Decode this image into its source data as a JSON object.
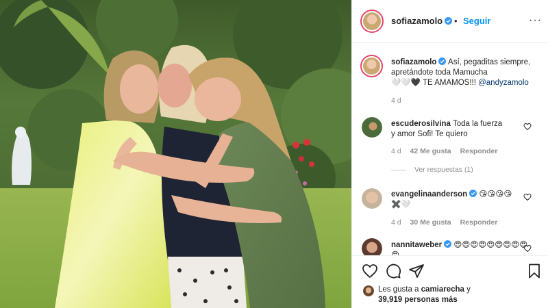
{
  "post": {
    "username": "sofiazamolo",
    "follow_label": "Seguir",
    "dot": "•",
    "more_label": "···"
  },
  "caption": {
    "username": "sofiazamolo",
    "text": "Así, pegaditas siempre, apretándote toda Mamucha",
    "text2": "🤍🤍🖤 TE AMAMOS!!! ",
    "mention": "@andyzamolo",
    "time": "4 d"
  },
  "comments": [
    {
      "username": "escuderosilvina",
      "text": "Toda la fuerza",
      "text2": "y amor Sofi! Te quiero",
      "time": "4 d",
      "likes": "42 Me gusta",
      "reply": "Responder",
      "view_replies": "Ver respuestas (1)"
    },
    {
      "username": "evangelinaanderson",
      "text": "😘😘😘😘",
      "text2": "✖️🤍",
      "time": "4 d",
      "likes": "30 Me gusta",
      "reply": "Responder"
    },
    {
      "username": "nannitaweber",
      "text": "😍😍😍😍😍😍😍😍😍😍"
    }
  ],
  "likes": {
    "prefix": "Les gusta a ",
    "user": "camiarecha",
    "suffix": " y",
    "count": "39,919",
    "count_suffix": " personas más"
  },
  "icons": {
    "like": "heart-icon",
    "comment": "comment-icon",
    "share": "share-icon",
    "save": "bookmark-icon",
    "verified": "verified-badge-icon",
    "more": "more-options-icon"
  },
  "colors": {
    "link_blue": "#0095f6",
    "mention": "#00376b",
    "muted": "#8e8e8e",
    "story_ring": "#e8436a"
  }
}
